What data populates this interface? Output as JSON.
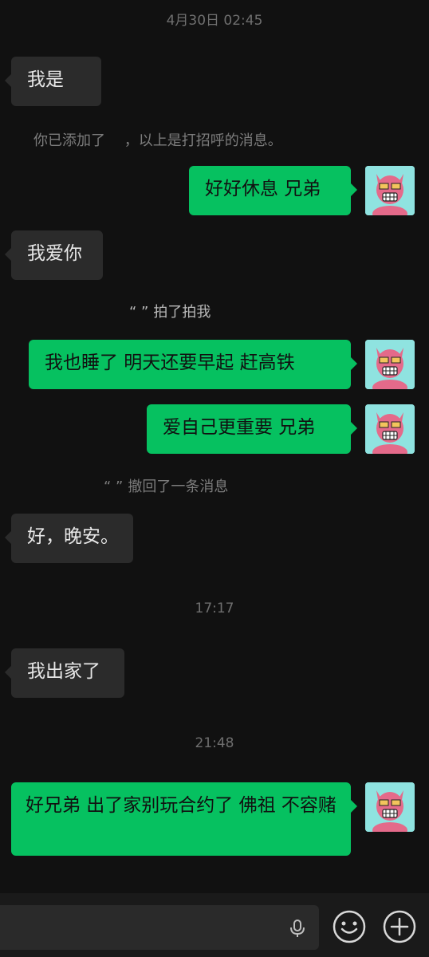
{
  "timestamps": [
    "4月30日 02:45",
    "17:17",
    "21:48"
  ],
  "messages": {
    "m1": "我是",
    "sys_added": "你已添加了　 ，以上是打招呼的消息。",
    "m2": "好好休息 兄弟",
    "m3": "我爱你",
    "sys_pat_quote": "“ ”",
    "sys_pat": "拍了拍我",
    "m4": "我也睡了  明天还要早起 赶高铁",
    "m5": "爱自己更重要 兄弟",
    "sys_recall_quote": "“ ”",
    "sys_recall": "撤回了一条消息",
    "m6": "好，晚安。",
    "m7": "我出家了",
    "m8": "好兄弟  出了家别玩合约了 佛祖 不容赌"
  },
  "input_bar": {
    "icons": [
      "microphone-icon",
      "emoji-icon",
      "plus-icon"
    ]
  },
  "colors": {
    "background": "#111111",
    "incoming_bubble": "#2b2b2b",
    "outgoing_bubble": "#06c160",
    "avatar_bg": "#8fe3e0",
    "avatar_face": "#e46a8a"
  }
}
